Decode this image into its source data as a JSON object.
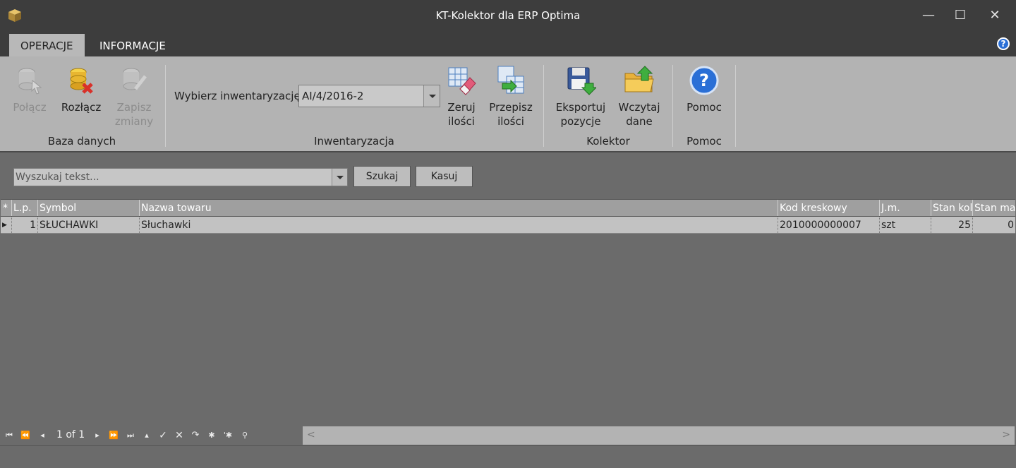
{
  "window": {
    "title": "KT-Kolektor dla ERP Optima",
    "icon": "box-icon"
  },
  "tabs": [
    {
      "label": "OPERACJE",
      "active": true
    },
    {
      "label": "INFORMACJE",
      "active": false
    }
  ],
  "ribbon": {
    "groups": {
      "baza": "Baza danych",
      "inwentaryzacja": "Inwentaryzacja",
      "kolektor": "Kolektor",
      "pomoc": "Pomoc"
    },
    "buttons": {
      "polacz": "Połącz",
      "rozlacz": "Rozłącz",
      "zapisz_1": "Zapisz",
      "zapisz_2": "zmiany",
      "zeruj_1": "Zeruj",
      "zeruj_2": "ilości",
      "przepisz_1": "Przepisz",
      "przepisz_2": "ilości",
      "eksport_1": "Eksportuj",
      "eksport_2": "pozycje",
      "wczytaj_1": "Wczytaj",
      "wczytaj_2": "dane",
      "pomoc": "Pomoc"
    },
    "inventory_label": "Wybierz inwentaryzację",
    "inventory_value": "AI/4/2016-2"
  },
  "search": {
    "placeholder": "Wyszukaj tekst...",
    "search_label": "Szukaj",
    "clear_label": "Kasuj"
  },
  "grid": {
    "columns": {
      "new": "*",
      "lp": "L.p.",
      "symbol": "Symbol",
      "nazwa": "Nazwa towaru",
      "kod": "Kod kreskowy",
      "jm": "J.m.",
      "stan_kol": "Stan kol",
      "stan_mag": "Stan ma"
    },
    "rows": [
      {
        "lp": "1",
        "symbol": "SŁUCHAWKI",
        "nazwa": "Słuchawki",
        "kod": "2010000000007",
        "jm": "szt",
        "stan_kol": "25",
        "stan_mag": "0"
      }
    ]
  },
  "navigator": {
    "page": "1 of 1"
  }
}
